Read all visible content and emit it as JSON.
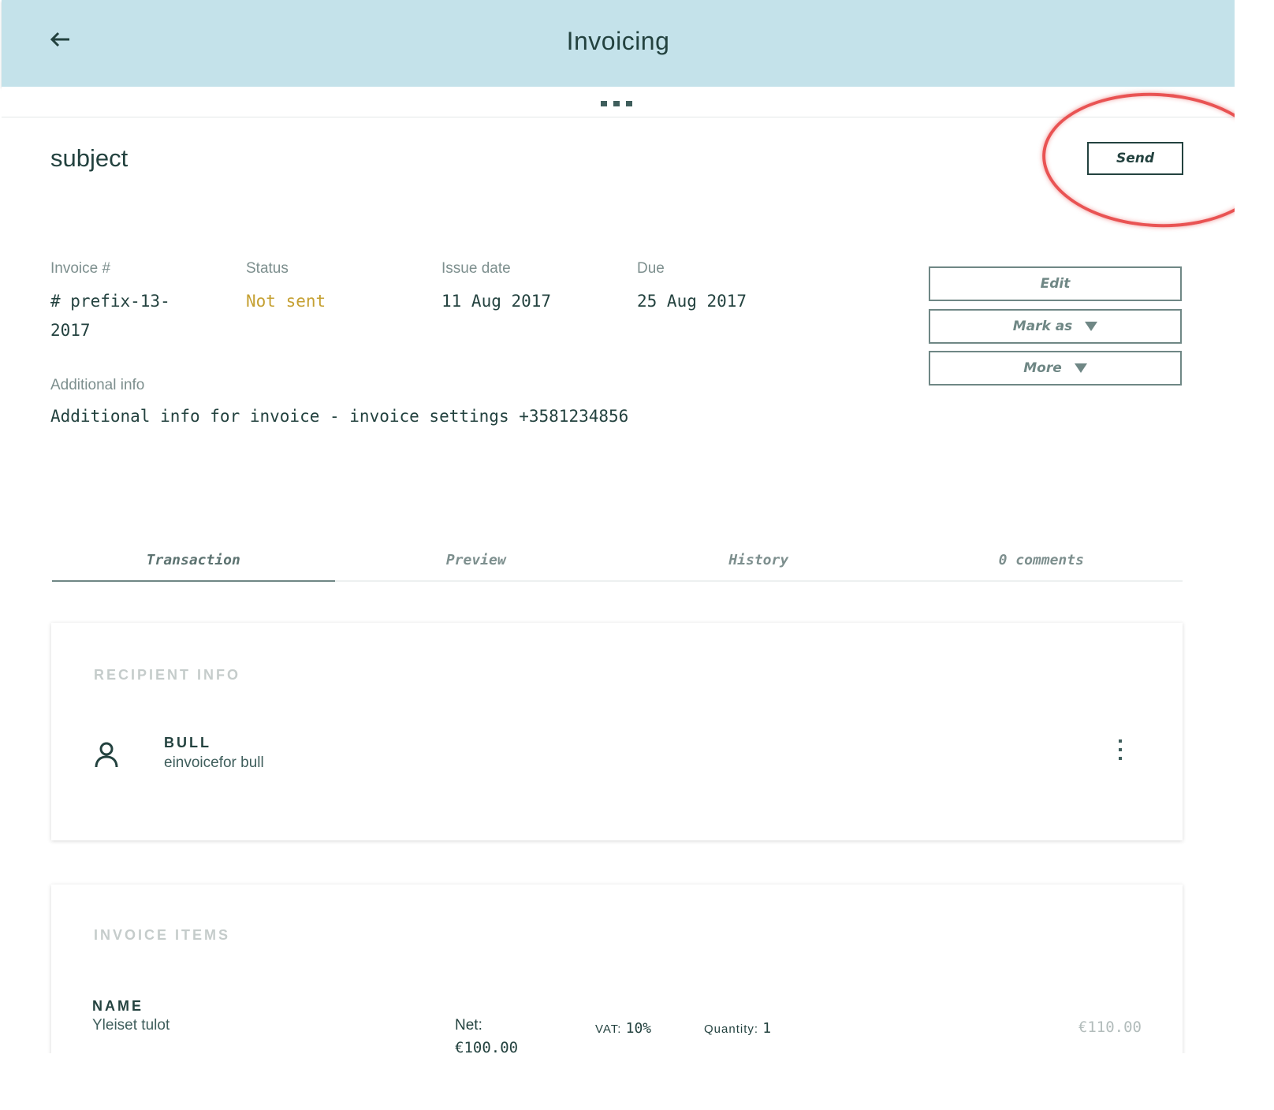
{
  "header": {
    "title": "Invoicing",
    "back_icon": "arrow-left-icon"
  },
  "invoice": {
    "subject": "subject",
    "send_label": "Send",
    "meta": [
      {
        "label": "Invoice #",
        "value": "# prefix-13-2017"
      },
      {
        "label": "Status",
        "value": "Not sent"
      },
      {
        "label": "Issue date",
        "value": "11 Aug 2017"
      },
      {
        "label": "Due",
        "value": "25 Aug 2017"
      }
    ],
    "additional_info_label": "Additional info",
    "additional_info": "Additional info for invoice - invoice settings +3581234856"
  },
  "actions": {
    "edit": "Edit",
    "mark_as": "Mark as",
    "more": "More"
  },
  "tabs": [
    "Transaction",
    "Preview",
    "History",
    "0 comments"
  ],
  "recipient": {
    "title": "RECIPIENT INFO",
    "name": "BULL",
    "sub": "einvoicefor bull"
  },
  "items": {
    "title": "INVOICE ITEMS",
    "name_label": "NAME",
    "row": {
      "name": "Yleiset tulot",
      "net_label": "Net:",
      "net_value": "€100.00",
      "vat_label": "VAT:",
      "vat_value": "10%",
      "qty_label": "Quantity:",
      "qty_value": "1",
      "total": "€110.00"
    }
  },
  "colors": {
    "header_bg": "#c4e2ea",
    "status_not_sent": "#c5a032",
    "annotation": "#e42828"
  }
}
